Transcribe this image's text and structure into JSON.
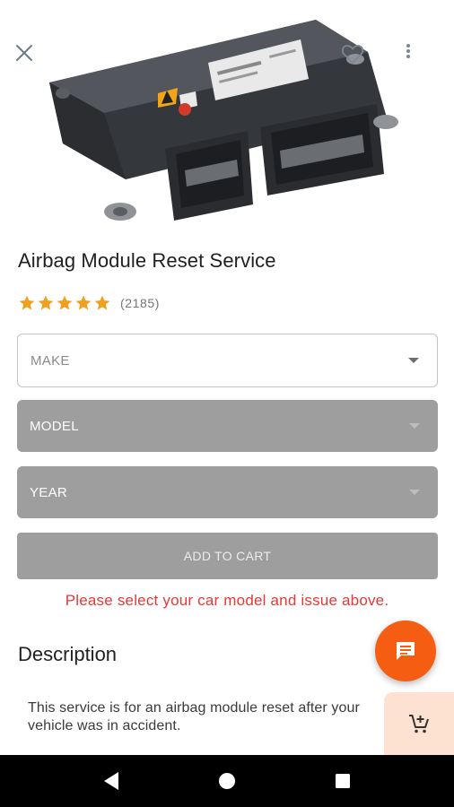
{
  "product": {
    "title": "Airbag Module Reset Service",
    "rating_count": "(2185)",
    "stars": 5
  },
  "form": {
    "make_placeholder": "MAKE",
    "model_placeholder": "MODEL",
    "year_placeholder": "YEAR",
    "add_to_cart_label": "ADD TO CART",
    "warning": "Please select your car model and issue above."
  },
  "description": {
    "heading": "Description",
    "text": "This service is for an airbag module reset after your vehicle was in accident."
  },
  "icons": {
    "close": "close-icon",
    "favorite": "heart-outline-icon",
    "more": "more-vertical-icon",
    "chat": "chat-icon",
    "cart": "add-cart-icon",
    "nav_back": "back-icon",
    "nav_home": "home-icon",
    "nav_recents": "recents-icon"
  },
  "colors": {
    "accent": "#f55d12",
    "star": "#f0a020",
    "disabled": "#9e9e9e",
    "warning": "#e53935",
    "cart_panel": "#fde2d2"
  }
}
